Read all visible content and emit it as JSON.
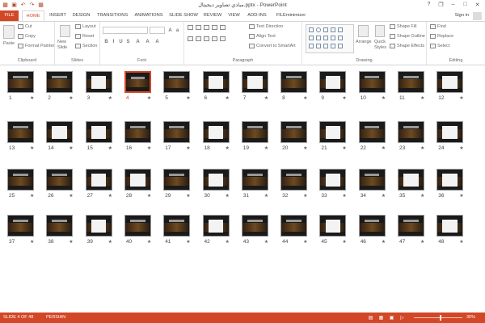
{
  "window": {
    "title": "مبادي تصاوير ديجيتال.pptx - PowerPoint",
    "controls": [
      "?",
      "❐",
      "–",
      "□",
      "✕"
    ]
  },
  "tabs": [
    {
      "label": "FILE"
    },
    {
      "label": "HOME"
    },
    {
      "label": "INSERT"
    },
    {
      "label": "DESIGN"
    },
    {
      "label": "TRANSITIONS"
    },
    {
      "label": "ANIMATIONS"
    },
    {
      "label": "SLIDE SHOW"
    },
    {
      "label": "REVIEW"
    },
    {
      "label": "VIEW"
    },
    {
      "label": "ADD-INS"
    },
    {
      "label": "FILEminimizer"
    }
  ],
  "account": {
    "sign_in": "Sign in"
  },
  "ribbon": {
    "clipboard": {
      "paste": "Paste",
      "cut": "Cut",
      "copy": "Copy",
      "format_painter": "Format Painter",
      "label": "Clipboard"
    },
    "slides": {
      "new_slide": "New Slide",
      "layout": "Layout",
      "reset": "Reset",
      "section": "Section",
      "label": "Slides"
    },
    "font": {
      "label": "Font"
    },
    "paragraph": {
      "text_direction": "Text Direction",
      "align_text": "Align Text",
      "convert_smartart": "Convert to SmartArt",
      "label": "Paragraph"
    },
    "drawing": {
      "arrange": "Arrange",
      "quick_styles": "Quick Styles",
      "shape_fill": "Shape Fill",
      "shape_outline": "Shape Outline",
      "shape_effects": "Shape Effects",
      "label": "Drawing"
    },
    "editing": {
      "find": "Find",
      "replace": "Replace",
      "select": "Select",
      "label": "Editing"
    }
  },
  "slides": [
    {
      "num": "1"
    },
    {
      "num": "2"
    },
    {
      "num": "3"
    },
    {
      "num": "4"
    },
    {
      "num": "5"
    },
    {
      "num": "6"
    },
    {
      "num": "7"
    },
    {
      "num": "8"
    },
    {
      "num": "9"
    },
    {
      "num": "10"
    },
    {
      "num": "11"
    },
    {
      "num": "12"
    },
    {
      "num": "13"
    },
    {
      "num": "14"
    },
    {
      "num": "15"
    },
    {
      "num": "16"
    },
    {
      "num": "17"
    },
    {
      "num": "18"
    },
    {
      "num": "19"
    },
    {
      "num": "20"
    },
    {
      "num": "21"
    },
    {
      "num": "22"
    },
    {
      "num": "23"
    },
    {
      "num": "24"
    },
    {
      "num": "25"
    },
    {
      "num": "26"
    },
    {
      "num": "27"
    },
    {
      "num": "28"
    },
    {
      "num": "29"
    },
    {
      "num": "30"
    },
    {
      "num": "31"
    },
    {
      "num": "32"
    },
    {
      "num": "33"
    },
    {
      "num": "34"
    },
    {
      "num": "35"
    },
    {
      "num": "36"
    },
    {
      "num": "37"
    },
    {
      "num": "38"
    },
    {
      "num": "39"
    },
    {
      "num": "40"
    },
    {
      "num": "41"
    },
    {
      "num": "42"
    },
    {
      "num": "43"
    },
    {
      "num": "44"
    },
    {
      "num": "45"
    },
    {
      "num": "46"
    },
    {
      "num": "47"
    },
    {
      "num": "48"
    }
  ],
  "selected_slide": 4,
  "transition_marker": "★",
  "status": {
    "slide_info": "SLIDE 4 OF 48",
    "language": "PERSIAN",
    "zoom": "30%"
  },
  "colors": {
    "accent": "#d24726"
  }
}
